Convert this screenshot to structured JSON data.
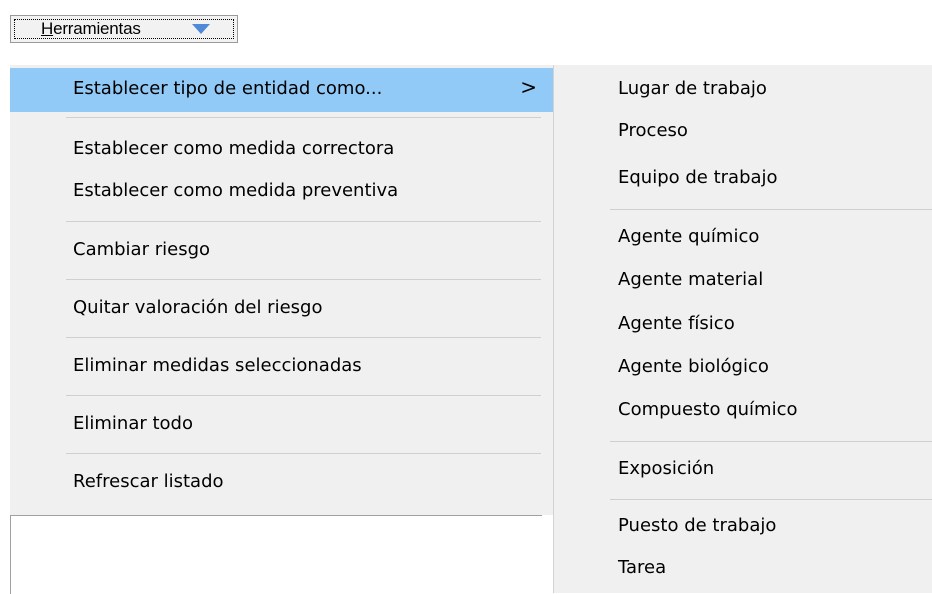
{
  "toolbar": {
    "button_label_prefix": "H",
    "button_label_rest": "erramientas",
    "dropdown_icon": "triangle-down-icon"
  },
  "main_menu": {
    "items": [
      {
        "label": "Establecer tipo de entidad como...",
        "submenu_glyph": ">"
      },
      {
        "label": "Establecer como medida correctora"
      },
      {
        "label": "Establecer como medida preventiva"
      },
      {
        "label": "Cambiar riesgo"
      },
      {
        "label": "Quitar valoración del riesgo"
      },
      {
        "label": "Eliminar medidas seleccionadas"
      },
      {
        "label": "Eliminar todo"
      },
      {
        "label": "Refrescar listado"
      }
    ]
  },
  "sub_menu": {
    "items": [
      {
        "label": "Lugar de trabajo"
      },
      {
        "label": "Proceso"
      },
      {
        "label": "Equipo de trabajo"
      },
      {
        "label": "Agente químico"
      },
      {
        "label": "Agente material"
      },
      {
        "label": "Agente físico"
      },
      {
        "label": "Agente biológico"
      },
      {
        "label": "Compuesto químico"
      },
      {
        "label": "Exposición"
      },
      {
        "label": "Puesto de trabajo"
      },
      {
        "label": "Tarea"
      }
    ]
  },
  "colors": {
    "highlight": "#91c9f7",
    "menu_bg": "#f0f0f0",
    "arrow": "#4f89d8"
  }
}
